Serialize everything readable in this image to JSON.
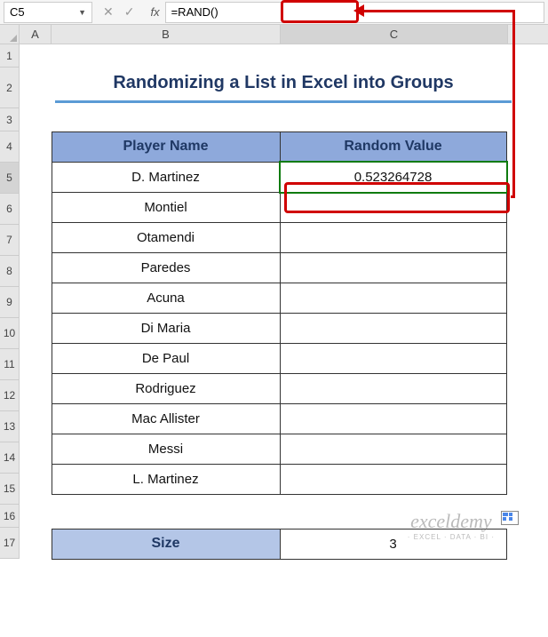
{
  "formula_bar": {
    "cell_ref": "C5",
    "formula": "=RAND()",
    "fx": "fx"
  },
  "columns": {
    "A": "A",
    "B": "B",
    "C": "C"
  },
  "rows": [
    "1",
    "2",
    "3",
    "4",
    "5",
    "6",
    "7",
    "8",
    "9",
    "10",
    "11",
    "12",
    "13",
    "14",
    "15",
    "16",
    "17"
  ],
  "title": "Randomizing a List in Excel into Groups",
  "headers": {
    "player": "Player Name",
    "random": "Random Value"
  },
  "players": [
    "D. Martinez",
    "Montiel",
    "Otamendi",
    "Paredes",
    "Acuna",
    "Di Maria",
    "De Paul",
    "Rodriguez",
    "Mac Allister",
    "Messi",
    "L. Martinez"
  ],
  "random_values": [
    "0.523264728",
    "",
    "",
    "",
    "",
    "",
    "",
    "",
    "",
    "",
    ""
  ],
  "size": {
    "label": "Size",
    "value": "3"
  },
  "chart_data": {
    "type": "table",
    "title": "Randomizing a List in Excel into Groups",
    "columns": [
      "Player Name",
      "Random Value"
    ],
    "rows": [
      [
        "D. Martinez",
        0.523264728
      ],
      [
        "Montiel",
        null
      ],
      [
        "Otamendi",
        null
      ],
      [
        "Paredes",
        null
      ],
      [
        "Acuna",
        null
      ],
      [
        "Di Maria",
        null
      ],
      [
        "De Paul",
        null
      ],
      [
        "Rodriguez",
        null
      ],
      [
        "Mac Allister",
        null
      ],
      [
        "Messi",
        null
      ],
      [
        "L. Martinez",
        null
      ]
    ],
    "meta": {
      "Size": 3,
      "formula_C5": "=RAND()"
    }
  },
  "watermark": {
    "brand": "exceldemy",
    "tag": "· EXCEL · DATA · BI ·"
  }
}
